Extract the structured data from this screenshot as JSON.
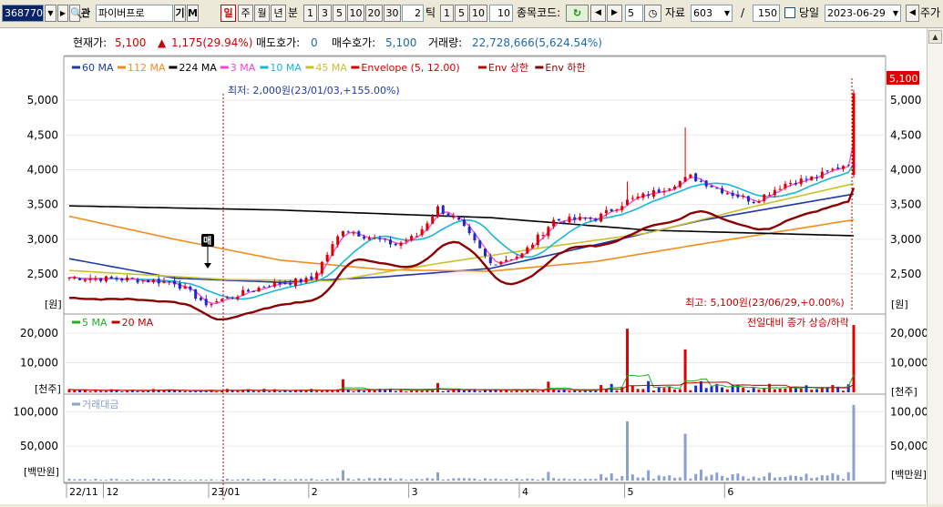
{
  "toolbar": {
    "code": "368770",
    "fav_label": "관",
    "search_value": "파이버프로",
    "group_label": "기",
    "mode_label": "M",
    "period_tabs": [
      "일",
      "주",
      "월",
      "년"
    ],
    "minute_label": "분",
    "interval_buttons": [
      "1",
      "3",
      "5",
      "10",
      "20",
      "30"
    ],
    "tick_value": "2",
    "tick_label": "틱",
    "tick_buttons": [
      "1",
      "5",
      "10"
    ],
    "count_value": "10",
    "stock_code_label": "종목코드:",
    "step_value": "5",
    "data_label": "자료",
    "data_count": "603",
    "slash": "/",
    "display_count": "150",
    "sameday_label": "당일",
    "date_value": "2023-06-29",
    "extra_label": "주가",
    "refresh_icon": "refresh-icon",
    "prev_icon": "triangle-left-icon",
    "next_icon": "triangle-right-icon",
    "clock_icon": "clock-icon"
  },
  "info_bar": {
    "current_price_label": "현재가:",
    "current_price": "5,100",
    "change": "1,175(29.94%)",
    "ask_label": "매도호가:",
    "ask": "0",
    "bid_label": "매수호가:",
    "bid": "5,100",
    "volume_label": "거래량:",
    "volume": "22,728,666(5,624.54%)"
  },
  "legend_main": [
    {
      "label": "60 MA",
      "color": "#1e3aa8"
    },
    {
      "label": "112 MA",
      "color": "#f28c1e"
    },
    {
      "label": "224 MA",
      "color": "#000000"
    },
    {
      "label": "3 MA",
      "color": "#ff40d0"
    },
    {
      "label": "10 MA",
      "color": "#18b6d8"
    },
    {
      "label": "45 MA",
      "color": "#c8c030"
    },
    {
      "label": "Envelope (5, 12.00)",
      "color": "#d00000"
    },
    {
      "label": "Env 상한",
      "color": "#d00000"
    },
    {
      "label": "Env 하한",
      "color": "#8b0000"
    }
  ],
  "legend_volume": [
    {
      "label": "5 MA",
      "color": "#20b020"
    },
    {
      "label": "20 MA",
      "color": "#c00000"
    }
  ],
  "legend_amount": [
    {
      "label": "거래대금",
      "color": "#8aa0d0"
    }
  ],
  "annotations": {
    "low": "최저: 2,000원(23/01/03,+155.00%)",
    "high": "최고: 5,100원(23/06/29,+0.00%)",
    "buy_marker": "매",
    "price_tag": "5,100",
    "volume_note": "전일대비 종가 상승/하락"
  },
  "units": {
    "price": "[원]",
    "volume": "[천주]",
    "amount": "[백만원]"
  },
  "chart_data": [
    {
      "type": "candlestick",
      "title": "",
      "y_ticks": [
        2500,
        3000,
        3500,
        4000,
        4500,
        5000
      ],
      "y_tick_labels": [
        "2,500",
        "3,000",
        "3,500",
        "4,000",
        "4,500",
        "5,000"
      ],
      "ylim": [
        1950,
        5250
      ],
      "x_labels": [
        "22/11",
        "12",
        "23/01",
        "2",
        "3",
        "4",
        "5",
        "6"
      ],
      "x_label_index": [
        0,
        7,
        27,
        46,
        65,
        86,
        106,
        125
      ],
      "n_bars": 150,
      "last_close": 5100,
      "min_price": 2000,
      "max_price": 5100,
      "ma_anchors": {
        "60 MA": [
          [
            0,
            2720
          ],
          [
            20,
            2440
          ],
          [
            40,
            2380
          ],
          [
            60,
            2460
          ],
          [
            80,
            2580
          ],
          [
            100,
            2920
          ],
          [
            120,
            3270
          ],
          [
            149,
            3650
          ]
        ],
        "112 MA": [
          [
            0,
            3330
          ],
          [
            20,
            3000
          ],
          [
            40,
            2700
          ],
          [
            60,
            2560
          ],
          [
            80,
            2540
          ],
          [
            100,
            2680
          ],
          [
            120,
            2930
          ],
          [
            149,
            3280
          ]
        ],
        "224 MA": [
          [
            0,
            3480
          ],
          [
            40,
            3420
          ],
          [
            80,
            3310
          ],
          [
            110,
            3130
          ],
          [
            149,
            3050
          ]
        ],
        "45 MA": [
          [
            0,
            2550
          ],
          [
            30,
            2420
          ],
          [
            50,
            2400
          ],
          [
            70,
            2650
          ],
          [
            90,
            2880
          ],
          [
            110,
            3090
          ],
          [
            130,
            3470
          ],
          [
            149,
            3800
          ]
        ]
      }
    },
    {
      "type": "bar",
      "title": "",
      "y_ticks": [
        10000,
        20000
      ],
      "y_tick_labels": [
        "10,000",
        "20,000"
      ],
      "ylim": [
        0,
        24000
      ],
      "peaks": [
        {
          "i": 106,
          "v": 21500
        },
        {
          "i": 117,
          "v": 14500
        },
        {
          "i": 149,
          "v": 22729
        }
      ]
    },
    {
      "type": "bar",
      "title": "",
      "y_ticks": [
        50000,
        100000
      ],
      "y_tick_labels": [
        "50,000",
        "100,000"
      ],
      "ylim": [
        0,
        115000
      ],
      "peaks": [
        {
          "i": 106,
          "v": 86000
        },
        {
          "i": 117,
          "v": 68000
        },
        {
          "i": 149,
          "v": 110000
        }
      ]
    }
  ]
}
